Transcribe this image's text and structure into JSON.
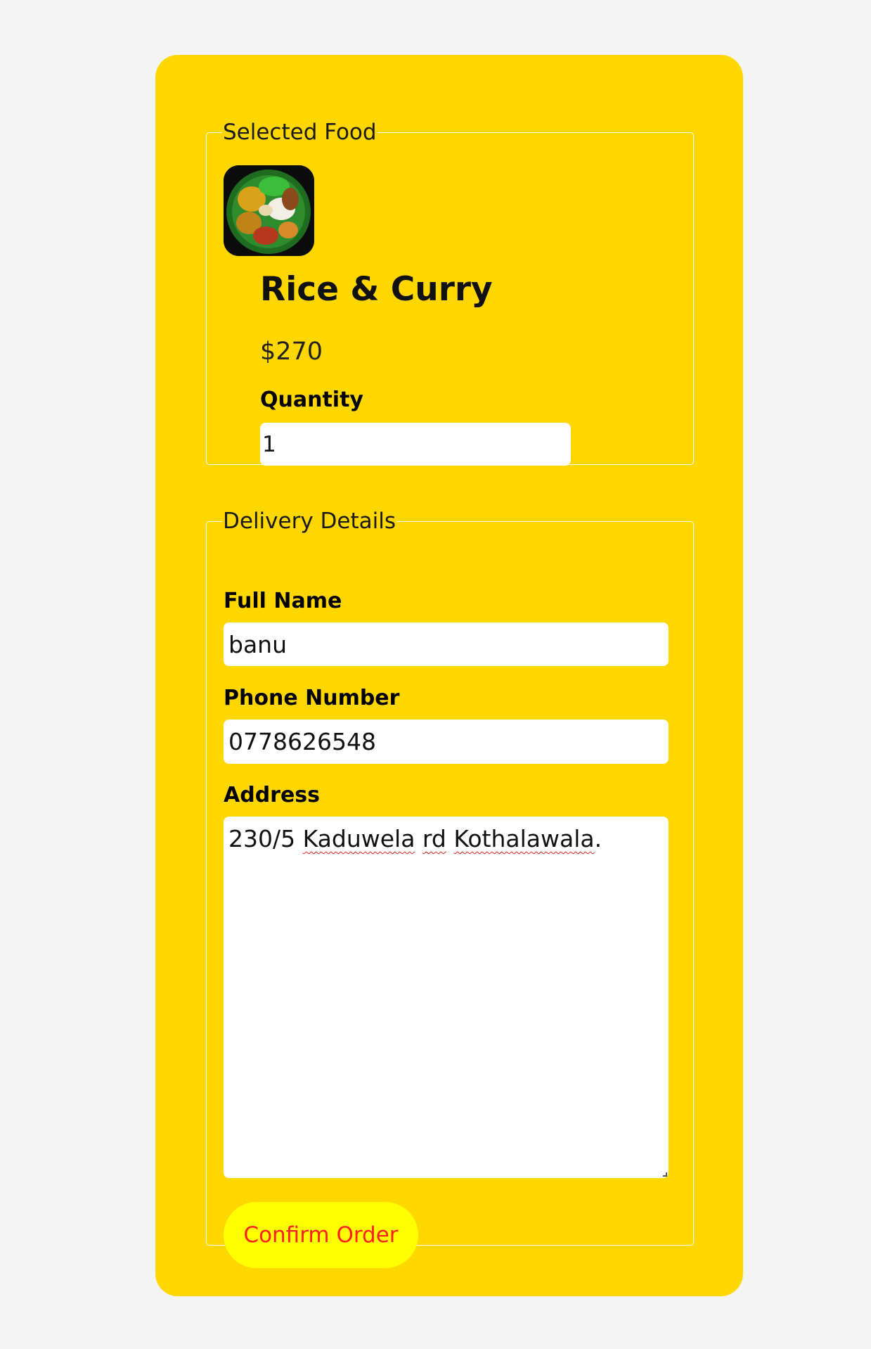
{
  "selected_food": {
    "legend": "Selected Food",
    "image_icon": "food-plate-image",
    "name": "Rice & Curry",
    "price": "$270",
    "quantity_label": "Quantity",
    "quantity_value": "1"
  },
  "delivery": {
    "legend": "Delivery Details",
    "full_name_label": "Full Name",
    "full_name_value": "banu",
    "phone_label": "Phone Number",
    "phone_value": "0778626548",
    "address_label": "Address",
    "address_parts": {
      "p1": "230/5 ",
      "w1": "Kaduwela",
      "s1": " ",
      "w2": "rd",
      "s2": " ",
      "w3": "Kothalawala",
      "p2": "."
    }
  },
  "confirm_label": "Confirm Order",
  "colors": {
    "card": "#ffd700",
    "page_bg": "#f4f4f4",
    "button_bg": "#ffff00",
    "button_text": "#ff2020"
  }
}
